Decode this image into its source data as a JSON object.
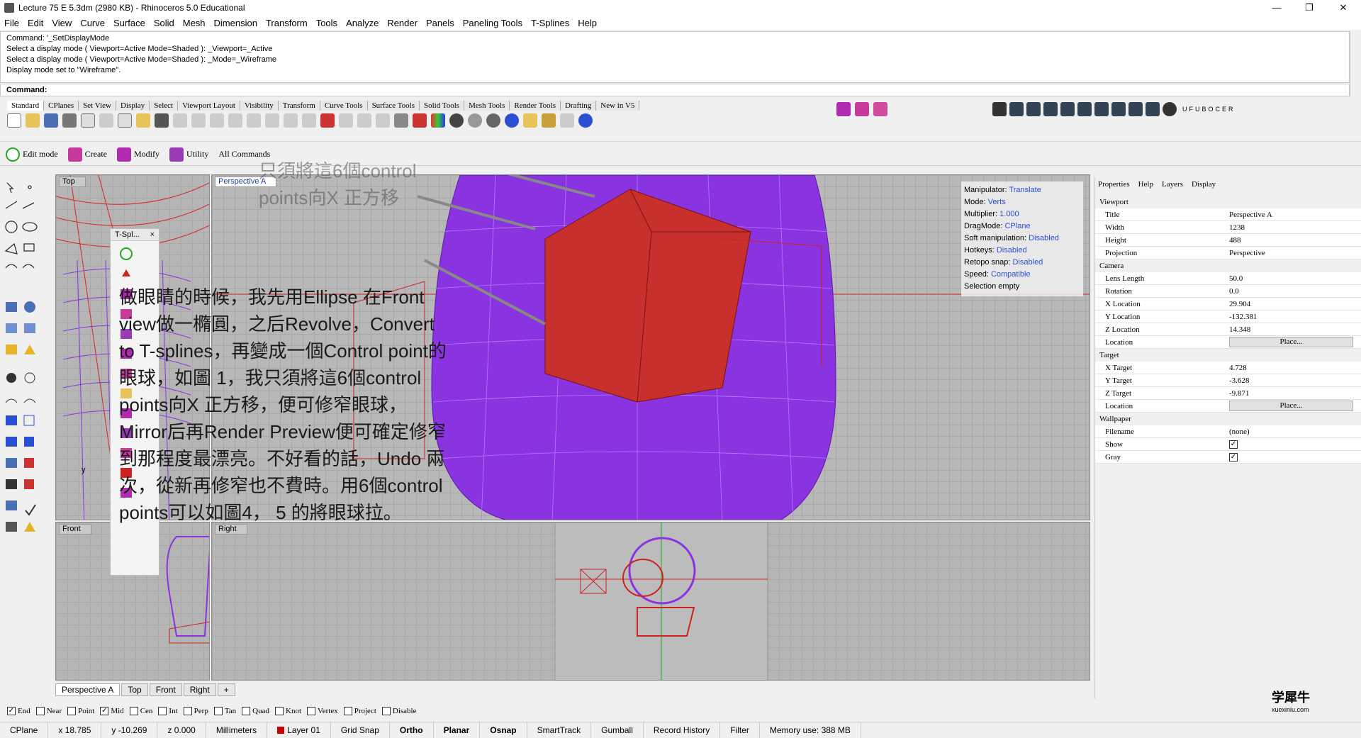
{
  "window": {
    "title": "Lecture 75 E 5.3dm (2980 KB) - Rhinoceros 5.0 Educational",
    "min": "—",
    "restore": "❐",
    "close": "✕"
  },
  "menu": [
    "File",
    "Edit",
    "View",
    "Curve",
    "Surface",
    "Solid",
    "Mesh",
    "Dimension",
    "Transform",
    "Tools",
    "Analyze",
    "Render",
    "Panels",
    "Paneling Tools",
    "T-Splines",
    "Help"
  ],
  "command_history": [
    "Command: '_SetDisplayMode",
    "Select a display mode ( Viewport=Active  Mode=Shaded ): _Viewport=_Active",
    "Select a display mode ( Viewport=Active  Mode=Shaded ): _Mode=_Wireframe",
    "Display mode set to \"Wireframe\"."
  ],
  "command_prompt": "Command:",
  "toolbar_tabs": [
    "Standard",
    "CPlanes",
    "Set View",
    "Display",
    "Select",
    "Viewport Layout",
    "Visibility",
    "Transform",
    "Curve Tools",
    "Surface Tools",
    "Solid Tools",
    "Mesh Tools",
    "Render Tools",
    "Drafting",
    "New in V5"
  ],
  "plugin_label": "UFUBOCER",
  "cmdbar": [
    "Edit mode",
    "Create",
    "Modify",
    "Utility",
    "All Commands"
  ],
  "viewports": {
    "top": "Top",
    "perspective": "Perspective A",
    "front": "Front",
    "right": "Right"
  },
  "viewport_tabs": [
    "Perspective A",
    "Top",
    "Front",
    "Right",
    "+"
  ],
  "tsplines_panel": {
    "title": "T-Spl...",
    "close": "×"
  },
  "manipulator": {
    "rows": [
      {
        "k": "Manipulator:",
        "v": "Translate"
      },
      {
        "k": "Mode:",
        "v": "Verts"
      },
      {
        "k": "Multiplier:",
        "v": "1.000"
      },
      {
        "k": "DragMode:",
        "v": "CPlane"
      },
      {
        "k": "Soft manipulation:",
        "v": "Disabled"
      },
      {
        "k": "Hotkeys:",
        "v": "Disabled"
      },
      {
        "k": "Retopo snap:",
        "v": "Disabled"
      },
      {
        "k": "Speed:",
        "v": "Compatible"
      },
      {
        "k": "Selection empty",
        "v": ""
      }
    ]
  },
  "annotation": {
    "callout": "只須將這6個control points向X 正方移",
    "body": "做眼睛的時候，我先用Ellipse 在Front view做一橢圓，之后Revolve，Convert to T-splines，再變成一個Control point的眼球，如圖 1，我只須將這6個control points向X 正方移，便可修窄眼球，Mirror后再Render Preview便可確定修窄到那程度最漂亮。不好看的話，Undo 兩次，從新再修窄也不費時。用6個control points可以如圖4， 5 的將眼球拉。"
  },
  "properties": {
    "tabs": [
      "Properties",
      "Help",
      "Layers",
      "Display"
    ],
    "sections": [
      {
        "title": "Viewport",
        "rows": [
          {
            "k": "Title",
            "v": "Perspective A"
          },
          {
            "k": "Width",
            "v": "1238"
          },
          {
            "k": "Height",
            "v": "488"
          },
          {
            "k": "Projection",
            "v": "Perspective"
          }
        ]
      },
      {
        "title": "Camera",
        "rows": [
          {
            "k": "Lens Length",
            "v": "50.0"
          },
          {
            "k": "Rotation",
            "v": "0.0"
          },
          {
            "k": "X Location",
            "v": "29.904"
          },
          {
            "k": "Y Location",
            "v": "-132.381"
          },
          {
            "k": "Z Location",
            "v": "14.348"
          },
          {
            "k": "Location",
            "v": "Place..."
          }
        ]
      },
      {
        "title": "Target",
        "rows": [
          {
            "k": "X Target",
            "v": "4.728"
          },
          {
            "k": "Y Target",
            "v": "-3.628"
          },
          {
            "k": "Z Target",
            "v": "-9.871"
          },
          {
            "k": "Location",
            "v": "Place..."
          }
        ]
      },
      {
        "title": "Wallpaper",
        "rows": [
          {
            "k": "Filename",
            "v": "(none)"
          },
          {
            "k": "Show",
            "v": "✓"
          },
          {
            "k": "Gray",
            "v": "✓"
          }
        ]
      }
    ]
  },
  "osnap": [
    {
      "label": "End",
      "checked": true
    },
    {
      "label": "Near",
      "checked": false
    },
    {
      "label": "Point",
      "checked": false
    },
    {
      "label": "Mid",
      "checked": true
    },
    {
      "label": "Cen",
      "checked": false
    },
    {
      "label": "Int",
      "checked": false
    },
    {
      "label": "Perp",
      "checked": false
    },
    {
      "label": "Tan",
      "checked": false
    },
    {
      "label": "Quad",
      "checked": false
    },
    {
      "label": "Knot",
      "checked": false
    },
    {
      "label": "Vertex",
      "checked": false
    },
    {
      "label": "Project",
      "checked": false
    },
    {
      "label": "Disable",
      "checked": false
    }
  ],
  "status": {
    "cplane": "CPlane",
    "x": "x 18.785",
    "y": "y -10.269",
    "z": "z 0.000",
    "units": "Millimeters",
    "layer": "Layer 01",
    "grid_snap": "Grid Snap",
    "ortho": "Ortho",
    "planar": "Planar",
    "osnap": "Osnap",
    "smarttrack": "SmartTrack",
    "gumball": "Gumball",
    "record_history": "Record History",
    "filter": "Filter",
    "memory": "Memory use: 388 MB"
  },
  "watermark": {
    "title": "学犀牛",
    "sub": "xuexiniu.com"
  },
  "colors": {
    "accent": "#2a4fd0",
    "purple": "#8a33e0",
    "red": "#c8302e",
    "layer": "#cc0000"
  }
}
